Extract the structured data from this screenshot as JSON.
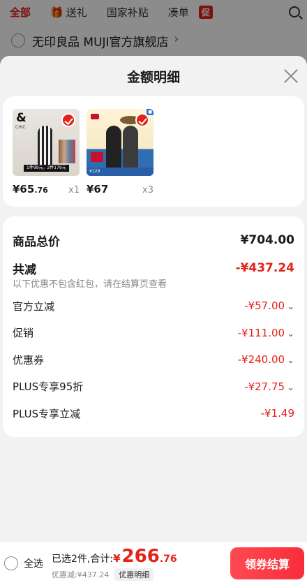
{
  "background": {
    "tabs": [
      "全部",
      "送礼",
      "国家补贴",
      "凑单",
      "促"
    ],
    "store_name": "无印良品 MUJI官方旗舰店"
  },
  "sheet": {
    "title": "金额明细"
  },
  "products": [
    {
      "price_main": "¥65",
      "price_decimal": ".76",
      "qty": "x1",
      "image_caption": "1件99元，2件179元"
    },
    {
      "price_main": "¥67",
      "price_decimal": "",
      "qty": "x3",
      "image_caption": "¥129"
    }
  ],
  "details": {
    "total_label": "商品总价",
    "total_value": "¥704.00",
    "discount_label": "共减",
    "discount_value": "-¥437.24",
    "note": "以下优惠不包含红包，请在结算页查看",
    "items": [
      {
        "label": "官方立减",
        "value": "-¥57.00",
        "expandable": true
      },
      {
        "label": "促销",
        "value": "-¥111.00",
        "expandable": true
      },
      {
        "label": "优惠券",
        "value": "-¥240.00",
        "expandable": true
      },
      {
        "label": "PLUS专享95折",
        "value": "-¥27.75",
        "expandable": true
      },
      {
        "label": "PLUS专享立减",
        "value": "-¥1.49",
        "expandable": false
      }
    ]
  },
  "bottom": {
    "select_all": "全选",
    "selected_text": "已选2件,合计:",
    "yen": "¥",
    "total_int": "266",
    "total_dec": ".76",
    "discount_text": "优惠减:¥437.24",
    "detail_tag": "优惠明细",
    "checkout": "领券结算"
  },
  "colors": {
    "accent": "#e2231a"
  }
}
